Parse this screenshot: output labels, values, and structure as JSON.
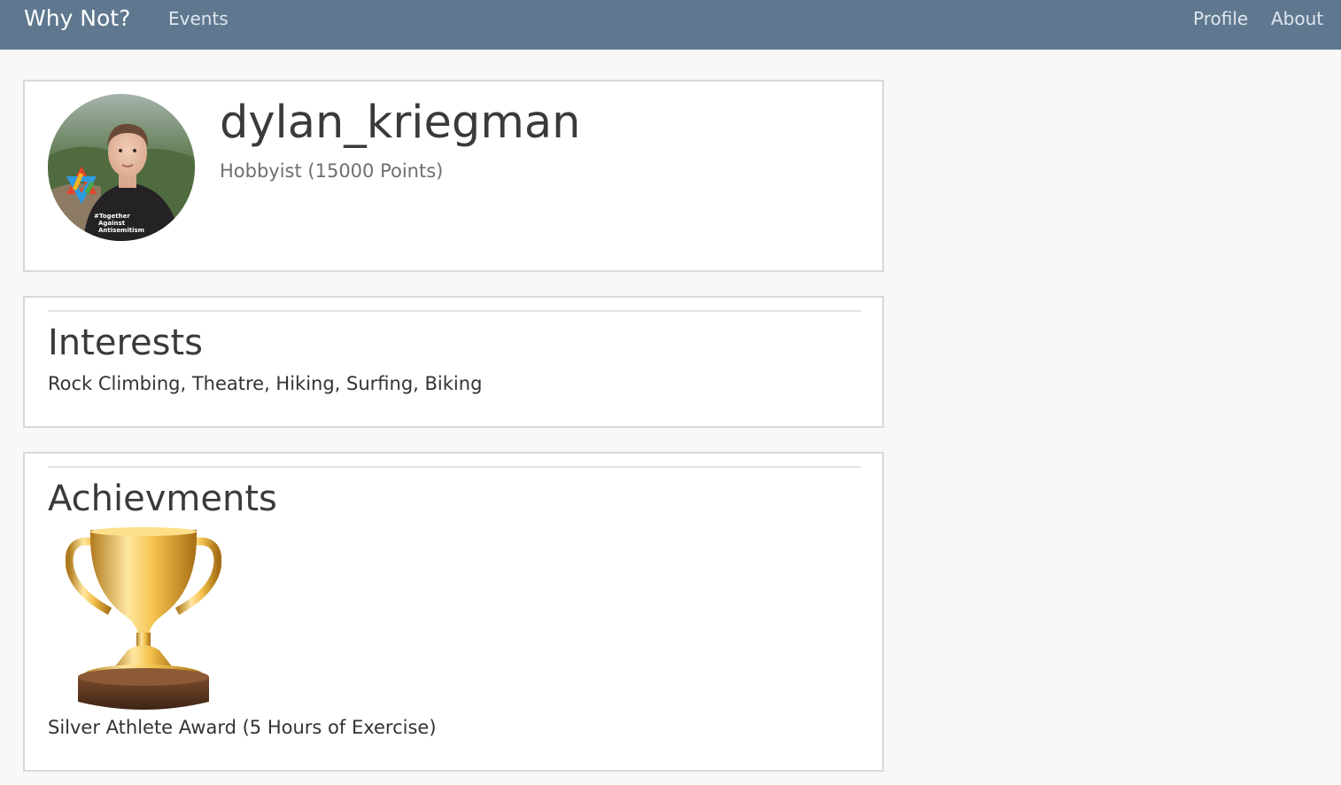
{
  "navbar": {
    "brand": "Why Not?",
    "links": {
      "events": "Events",
      "profile": "Profile",
      "about": "About"
    }
  },
  "profile": {
    "username": "dylan_kriegman",
    "rank": "Hobbyist (15000 Points)",
    "avatar_badge": [
      "#Together",
      "Against",
      "Antisemitism"
    ]
  },
  "interests": {
    "title": "Interests",
    "text": "Rock Climbing, Theatre, Hiking, Surfing, Biking"
  },
  "achievements": {
    "title": "Achievments",
    "award_icon": "trophy-icon",
    "award_label": "Silver Athlete Award (5 Hours of Exercise)"
  },
  "colors": {
    "navbar": "#5f788f",
    "page_background": "#f8f8f8",
    "card_border": "#d9d9d9"
  }
}
